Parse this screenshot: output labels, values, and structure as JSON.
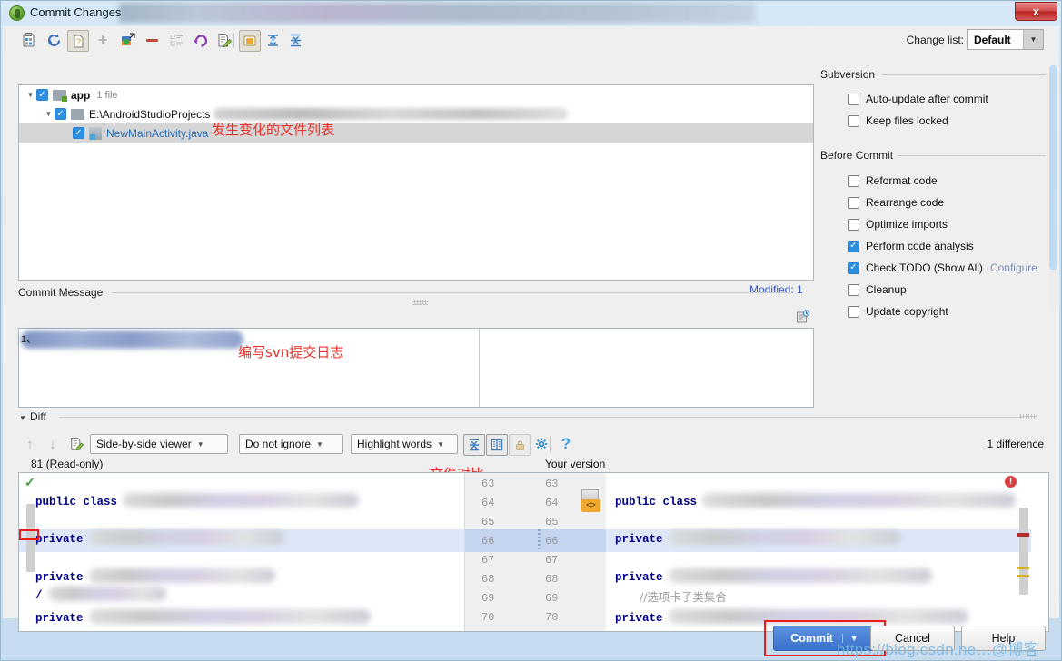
{
  "window": {
    "title": "Commit Changes",
    "app_icon": "android-studio-icon",
    "close_label": "x"
  },
  "toolbar": {
    "icons": [
      {
        "name": "show-diff-icon",
        "glyph": "⌸"
      },
      {
        "name": "refresh-icon",
        "glyph": "↻"
      },
      {
        "name": "unversioned-files-icon",
        "glyph": "?"
      },
      {
        "name": "add-icon",
        "glyph": "+"
      },
      {
        "name": "move-to-changelist-icon",
        "glyph": "↗"
      },
      {
        "name": "delete-icon",
        "glyph": "—"
      },
      {
        "name": "group-by-icon",
        "glyph": "≡"
      },
      {
        "name": "revert-icon",
        "glyph": "↶"
      },
      {
        "name": "edit-source-icon",
        "glyph": "✎"
      },
      {
        "name": "group-by-directory-icon",
        "glyph": "▣"
      },
      {
        "name": "expand-all-icon",
        "glyph": "⤒"
      },
      {
        "name": "collapse-all-icon",
        "glyph": "⤓"
      }
    ],
    "changelist_label": "Change list:",
    "changelist_value": "Default",
    "changelist_caret": "▼"
  },
  "file_tree": {
    "rows": [
      {
        "indent": 0,
        "twisty": "▼",
        "checked": true,
        "icon": "folder-green-icon",
        "label": "app",
        "count": "1 file",
        "blur_width": 0,
        "selected": false,
        "link": false
      },
      {
        "indent": 1,
        "twisty": "▼",
        "checked": true,
        "icon": "folder-icon",
        "label": "E:\\AndroidStudioProjects",
        "count": "",
        "blur_width": 390,
        "selected": false,
        "link": false
      },
      {
        "indent": 2,
        "twisty": "",
        "checked": true,
        "icon": "java-file-icon",
        "label": "NewMainActivity.java",
        "count": "",
        "blur_width": 0,
        "selected": true,
        "link": true
      }
    ],
    "annotation": "发生变化的文件列表",
    "modified_label": "Modified: 1"
  },
  "commit_message": {
    "section_title": "Commit Message",
    "line_number": "1、",
    "annotation": "编写svn提交日志",
    "history_icon": "message-history-icon"
  },
  "diff": {
    "section_title": "Diff",
    "prev_icon": "↑",
    "next_icon": "↓",
    "edit_icon": "✎",
    "viewer_mode": "Side-by-side viewer",
    "ignore_mode": "Do not ignore",
    "highlight_mode": "Highlight words",
    "collapse_icon": "⤓",
    "columns_icon": "◫",
    "lock_icon": "ὑ2",
    "settings_icon": "⚙",
    "help_icon": "?",
    "difference_count": "1 difference",
    "left_header": "81 (Read-only)",
    "right_header": "Your version",
    "annotation": "文件对比",
    "left_lines": [
      {
        "code": "public class",
        "blur": 480
      },
      {
        "code": "  private",
        "blur": 290
      },
      {
        "code": "  private",
        "blur": 300
      },
      {
        "code": "  /",
        "blur": 160
      },
      {
        "code": "  private",
        "blur": 340
      }
    ],
    "right_lines": [
      {
        "code": "public class",
        "blur": 390
      },
      {
        "code": "  private",
        "blur": 300
      },
      {
        "code": "  private",
        "blur": 300
      },
      {
        "code": "  //选项卡子类集合",
        "blur": 0
      },
      {
        "code": "  private",
        "blur": 300
      }
    ],
    "gutter_left": [
      "63",
      "64",
      "65",
      "66",
      "67",
      "68",
      "69",
      "70"
    ],
    "gutter_right": [
      "63",
      "64",
      "65",
      "66",
      "67",
      "68",
      "69",
      "70"
    ],
    "code_tag": "<>"
  },
  "options": {
    "subversion": {
      "title": "Subversion",
      "items": [
        {
          "label": "Auto-update after commit",
          "checked": false,
          "mnemonic": ""
        },
        {
          "label": "Keep files locked",
          "checked": false,
          "mnemonic": "K"
        }
      ]
    },
    "before_commit": {
      "title": "Before Commit",
      "items": [
        {
          "label": "Reformat code",
          "checked": false,
          "mnemonic": "R",
          "link": ""
        },
        {
          "label": "Rearrange code",
          "checked": false,
          "mnemonic": "n",
          "link": ""
        },
        {
          "label": "Optimize imports",
          "checked": false,
          "mnemonic": "O",
          "link": ""
        },
        {
          "label": "Perform code analysis",
          "checked": true,
          "mnemonic": "s",
          "link": ""
        },
        {
          "label": "Check TODO (Show All)",
          "checked": true,
          "mnemonic": "",
          "link": "Configure"
        },
        {
          "label": "Cleanup",
          "checked": false,
          "mnemonic": "l",
          "link": ""
        },
        {
          "label": "Update copyright",
          "checked": false,
          "mnemonic": "",
          "link": ""
        }
      ]
    }
  },
  "footer": {
    "commit_label": "Commit",
    "commit_caret": "▼",
    "cancel_label": "Cancel",
    "help_label": "Help"
  },
  "watermark": "https://blog.csdn.ne…@博客",
  "colors": {
    "accent": "#3a72cc",
    "checkbox_on": "#2d8fe0",
    "annotation_red": "#e8312a",
    "link_blue": "#2a6fb8"
  }
}
